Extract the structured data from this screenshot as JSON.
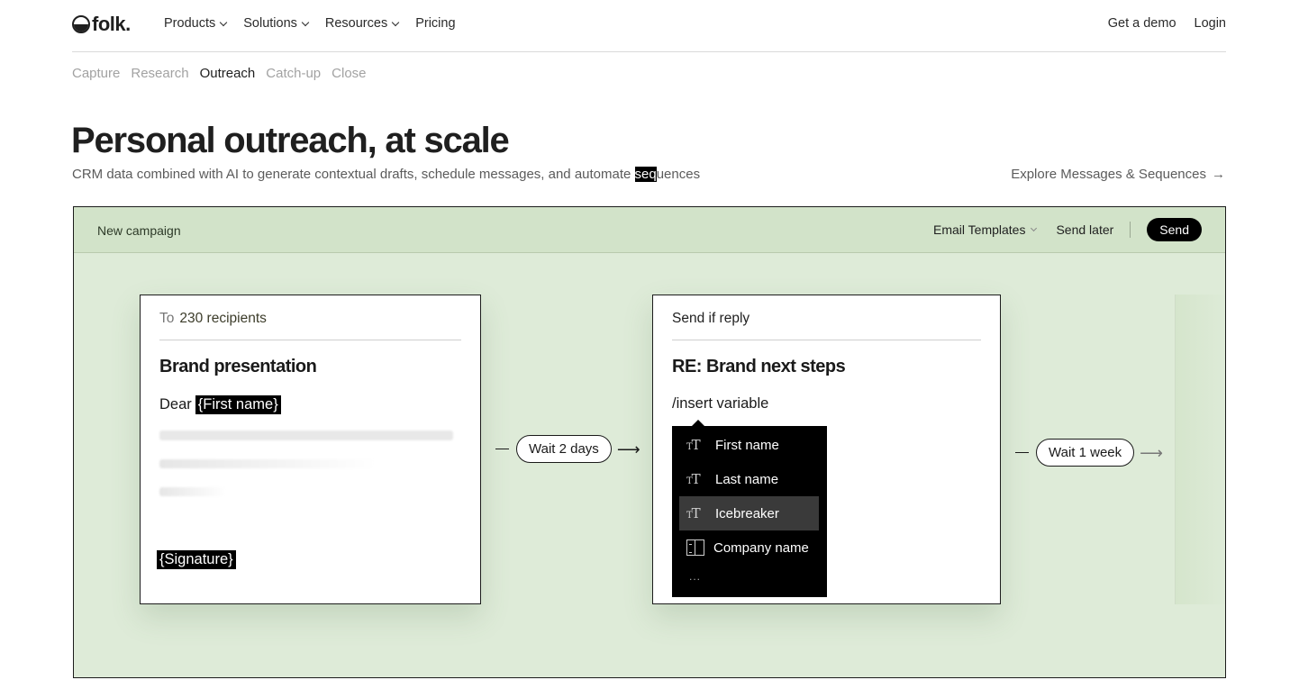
{
  "nav": {
    "logo_text": "folk.",
    "links": [
      {
        "label": "Products"
      },
      {
        "label": "Solutions"
      },
      {
        "label": "Resources"
      },
      {
        "label": "Pricing"
      }
    ],
    "right": {
      "demo": "Get a demo",
      "login": "Login"
    }
  },
  "subtabs": [
    "Capture",
    "Research",
    "Outreach",
    "Catch-up",
    "Close"
  ],
  "active_subtab": "Outreach",
  "hero": {
    "title": "Personal outreach, at scale",
    "subtitle_before": "CRM data combined with AI to generate contextual drafts, schedule messages, and automate ",
    "subtitle_highlight": "seq",
    "subtitle_after": "uences",
    "explore_link": "Explore Messages & Sequences",
    "explore_arrow": "→"
  },
  "campaign": {
    "title": "New campaign",
    "templates": "Email Templates",
    "send_later": "Send later",
    "send": "Send",
    "card1": {
      "to_label": "To",
      "recipients": "230 recipients",
      "subject": "Brand presentation",
      "greeting": "Dear",
      "first_name_chip": "{First name}",
      "signature_chip": "{Signature}"
    },
    "wait1": "Wait 2 days",
    "card2": {
      "header": "Send if reply",
      "subject": "RE: Brand next steps",
      "insert": "/insert variable",
      "dropdown_items": [
        "First name",
        "Last name",
        "Icebreaker",
        "Company name"
      ],
      "selected_item": "Icebreaker",
      "more": "..."
    },
    "wait2": "Wait 1 week",
    "arrow": "⟶"
  },
  "colors": {
    "frame_bg": "#deebd8",
    "frame_bar": "#d2e3c9",
    "send_button": "#000000"
  }
}
